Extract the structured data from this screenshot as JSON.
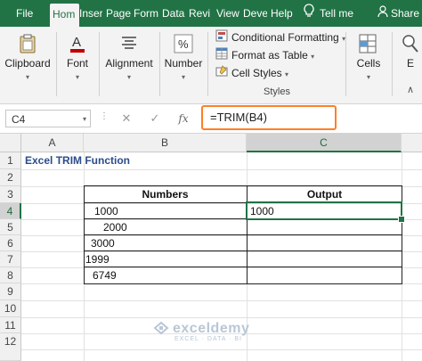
{
  "ribbon_tabs": {
    "file": "File",
    "home": "Hom",
    "insert": "Inser",
    "page_layout": "Page",
    "formulas": "Form",
    "data": "Data",
    "review": "Revi",
    "view": "View",
    "developer": "Deve",
    "help": "Help",
    "tell_me": "Tell me",
    "share": "Share"
  },
  "ribbon": {
    "clipboard": "Clipboard",
    "font": "Font",
    "alignment": "Alignment",
    "number": "Number",
    "conditional_formatting": "Conditional Formatting",
    "format_as_table": "Format as Table",
    "cell_styles": "Cell Styles",
    "styles_group": "Styles",
    "cells": "Cells",
    "editing": "E"
  },
  "formula_bar": {
    "name_box": "C4",
    "cancel": "✕",
    "enter": "✓",
    "fx": "fx",
    "formula": "=TRIM(B4)"
  },
  "grid": {
    "columns": [
      "A",
      "B",
      "C"
    ],
    "rows": [
      "1",
      "2",
      "3",
      "4",
      "5",
      "6",
      "7",
      "8",
      "9",
      "10",
      "11",
      "12"
    ],
    "selected_cell": "C4"
  },
  "sheet": {
    "title": "Excel TRIM Function",
    "header_numbers": "Numbers",
    "header_output": "Output",
    "numbers": [
      "1000",
      "2000",
      "3000",
      "1999",
      "6749"
    ],
    "output_c4": "1000"
  },
  "watermark": {
    "brand": "exceldemy",
    "tagline": "EXCEL · DATA · BI"
  },
  "colors": {
    "excel_green": "#217346",
    "highlight_orange": "#ff7f27",
    "title_blue": "#2b4c8c"
  }
}
